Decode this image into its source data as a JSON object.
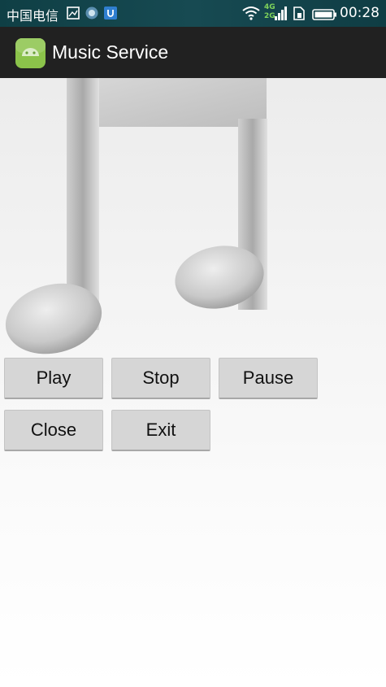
{
  "status_bar": {
    "carrier": "中国电信",
    "network_top": "4G",
    "network_bottom": "2G",
    "time": "00:28"
  },
  "app_bar": {
    "title": "Music Service"
  },
  "buttons": {
    "play": "Play",
    "stop": "Stop",
    "pause": "Pause",
    "close": "Close",
    "exit": "Exit"
  },
  "colors": {
    "status_bar": "#174a52",
    "app_bar": "#212121",
    "button_bg": "#d6d6d6"
  },
  "icons": [
    "gallery-icon",
    "app-notification-icon",
    "shield-notification-icon",
    "wifi-icon",
    "signal-icon",
    "sim-icon",
    "battery-icon",
    "android-app-icon",
    "music-note-image"
  ]
}
